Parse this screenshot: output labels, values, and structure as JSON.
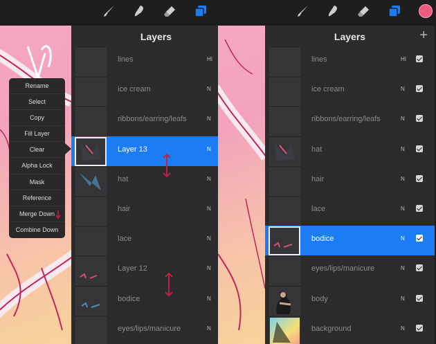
{
  "left": {
    "panel": {
      "title": "Layers",
      "add_icon": "plus-icon"
    },
    "layers": [
      {
        "name": "lines",
        "mode": "HI",
        "selected": false
      },
      {
        "name": "ice cream",
        "mode": "N",
        "selected": false
      },
      {
        "name": "ribbons/earring/leafs",
        "mode": "N",
        "selected": false
      },
      {
        "name": "Layer 13",
        "mode": "N",
        "selected": true
      },
      {
        "name": "hat",
        "mode": "N",
        "selected": false
      },
      {
        "name": "hair",
        "mode": "N",
        "selected": false
      },
      {
        "name": "lace",
        "mode": "N",
        "selected": false
      },
      {
        "name": "Layer 12",
        "mode": "N",
        "selected": false
      },
      {
        "name": "bodice",
        "mode": "N",
        "selected": false
      },
      {
        "name": "eyes/lips/manicure",
        "mode": "N",
        "selected": false
      }
    ],
    "menu": [
      "Rename",
      "Select",
      "Copy",
      "Fill Layer",
      "Clear",
      "Alpha Lock",
      "Mask",
      "Reference",
      "Merge Down",
      "Combine Down"
    ]
  },
  "right": {
    "panel": {
      "title": "Layers",
      "add_icon": "plus-icon"
    },
    "layers": [
      {
        "name": "lines",
        "mode": "HI",
        "selected": false
      },
      {
        "name": "ice cream",
        "mode": "N",
        "selected": false
      },
      {
        "name": "ribbons/earring/leafs",
        "mode": "N",
        "selected": false
      },
      {
        "name": "hat",
        "mode": "N",
        "selected": false
      },
      {
        "name": "hair",
        "mode": "N",
        "selected": false
      },
      {
        "name": "lace",
        "mode": "N",
        "selected": false
      },
      {
        "name": "bodice",
        "mode": "N",
        "selected": true
      },
      {
        "name": "eyes/lips/manicure",
        "mode": "N",
        "selected": false
      },
      {
        "name": "body",
        "mode": "N",
        "selected": false
      },
      {
        "name": "background",
        "mode": "N",
        "selected": false
      }
    ]
  },
  "toolbar": {
    "tools": [
      "brush-icon",
      "smudge-icon",
      "eraser-icon",
      "layers-icon"
    ],
    "color": "#ec5b7c",
    "accent": "#1b7cf4"
  }
}
